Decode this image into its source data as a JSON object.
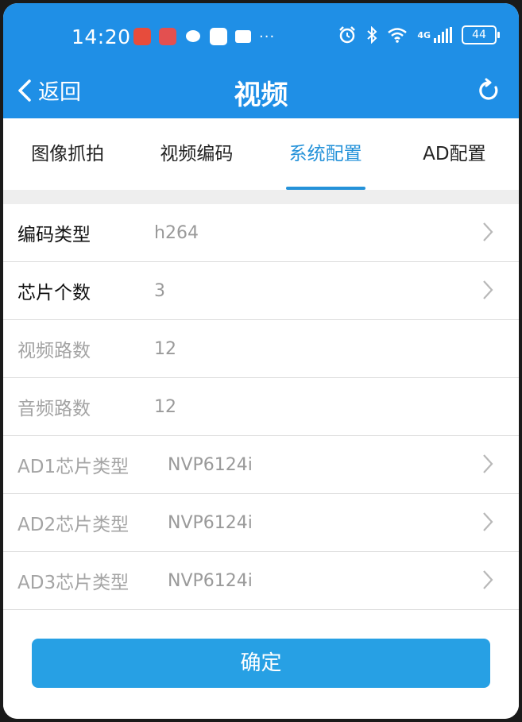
{
  "status_bar": {
    "time": "14:20",
    "battery": "44",
    "network": "4G",
    "icons": [
      "app-huawei-icon",
      "app-red-icon",
      "chat-bubble-icon",
      "app-white-icon",
      "mail-icon",
      "more-dots-icon",
      "alarm-icon",
      "bluetooth-icon",
      "wifi-icon",
      "signal-icon",
      "battery-icon"
    ],
    "more": "···"
  },
  "header": {
    "back_label": "返回",
    "title": "视频",
    "refresh_icon": "refresh-icon"
  },
  "tabs": [
    {
      "label": "图像抓拍",
      "active": false
    },
    {
      "label": "视频编码",
      "active": false
    },
    {
      "label": "系统配置",
      "active": true
    },
    {
      "label": "AD配置",
      "active": false
    }
  ],
  "rows": [
    {
      "label": "编码类型",
      "value": "h264",
      "editable": true,
      "chevron": true
    },
    {
      "label": "芯片个数",
      "value": "3",
      "editable": true,
      "chevron": true
    },
    {
      "label": "视频路数",
      "value": "12",
      "editable": false,
      "chevron": false
    },
    {
      "label": "音频路数",
      "value": "12",
      "editable": false,
      "chevron": false
    },
    {
      "label": "AD1芯片类型",
      "value": "NVP6124i",
      "editable": false,
      "chevron": true
    },
    {
      "label": "AD2芯片类型",
      "value": "NVP6124i",
      "editable": false,
      "chevron": true
    },
    {
      "label": "AD3芯片类型",
      "value": "NVP6124i",
      "editable": false,
      "chevron": true
    }
  ],
  "confirm_label": "确定",
  "colors": {
    "primary": "#1f8fe6",
    "tab_active": "#2592d9",
    "button": "#27a0e4"
  }
}
